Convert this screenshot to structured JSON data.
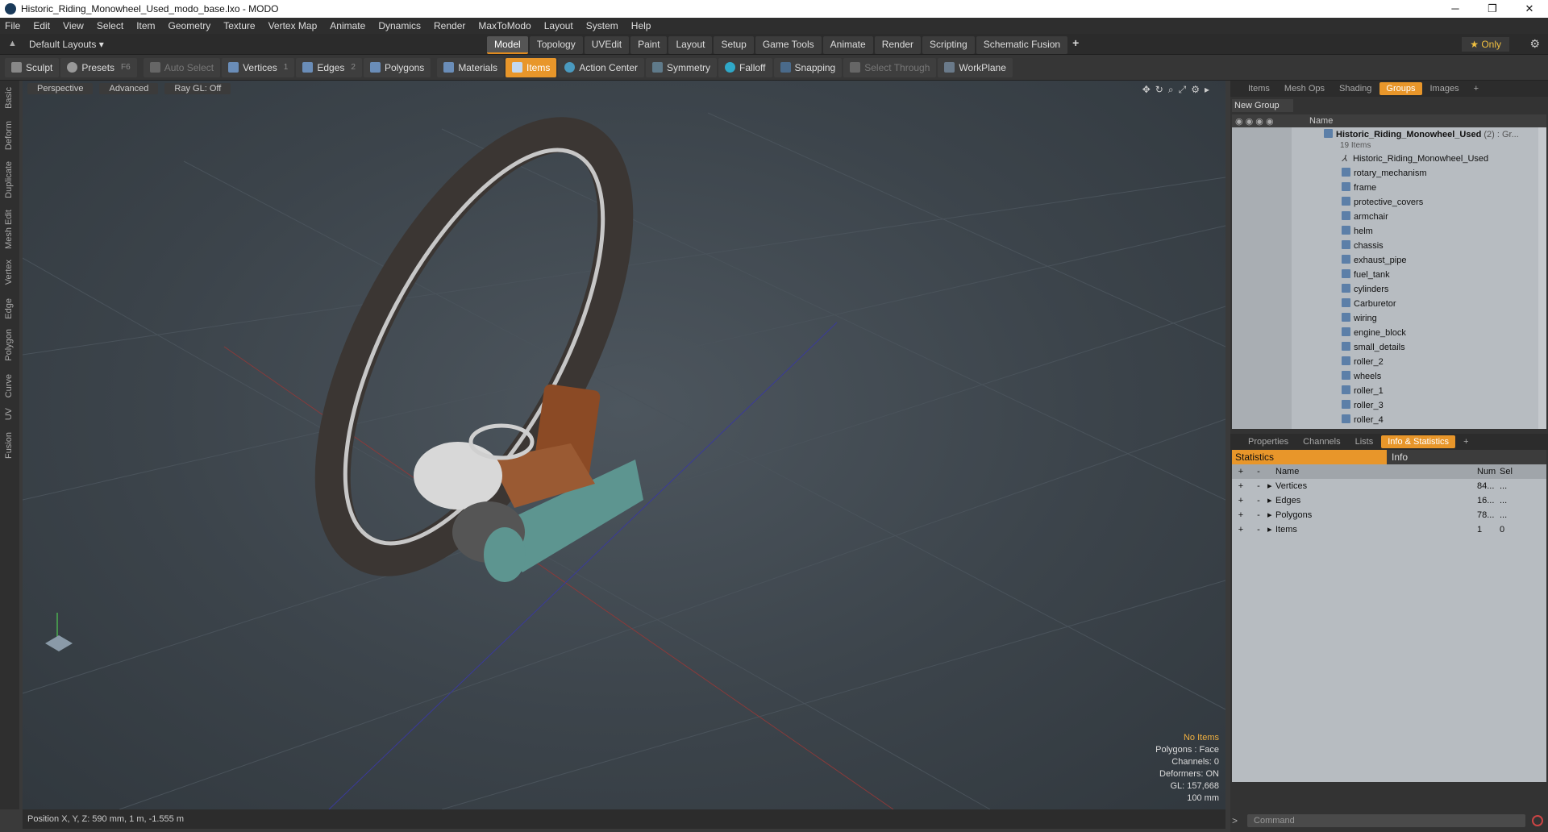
{
  "window": {
    "title": "Historic_Riding_Monowheel_Used_modo_base.lxo - MODO",
    "min": "─",
    "max": "❐",
    "close": "✕"
  },
  "menu": [
    "File",
    "Edit",
    "View",
    "Select",
    "Item",
    "Geometry",
    "Texture",
    "Vertex Map",
    "Animate",
    "Dynamics",
    "Render",
    "MaxToModo",
    "Layout",
    "System",
    "Help"
  ],
  "layout": {
    "default_layouts": "Default Layouts ▾",
    "only": "★ Only"
  },
  "tabs": [
    "Model",
    "Topology",
    "UVEdit",
    "Paint",
    "Layout",
    "Setup",
    "Game Tools",
    "Animate",
    "Render",
    "Scripting",
    "Schematic Fusion"
  ],
  "toolbar": {
    "sculpt": "Sculpt",
    "presets": "Presets",
    "presets_key": "F6",
    "auto_select": "Auto Select",
    "vertices": "Vertices",
    "vertices_n": "1",
    "edges": "Edges",
    "edges_n": "2",
    "polygons": "Polygons",
    "materials": "Materials",
    "items": "Items",
    "action_center": "Action Center",
    "symmetry": "Symmetry",
    "falloff": "Falloff",
    "snapping": "Snapping",
    "select_through": "Select Through",
    "workplane": "WorkPlane"
  },
  "left_tabs": [
    "Basic",
    "Deform",
    "Duplicate",
    "Mesh Edit",
    "Vertex",
    "Edge",
    "Polygon",
    "Curve",
    "UV",
    "Fusion"
  ],
  "viewport": {
    "perspective": "Perspective",
    "advanced": "Advanced",
    "raygl": "Ray GL: Off",
    "info": {
      "no_items": "No Items",
      "polygons": "Polygons : Face",
      "channels": "Channels: 0",
      "deformers": "Deformers: ON",
      "gl": "GL: 157,668",
      "scale": "100 mm"
    }
  },
  "status": {
    "position": "Position X, Y, Z:   590 mm, 1 m, -1.555 m"
  },
  "panel_tabs_top": [
    "Items",
    "Mesh Ops",
    "Shading",
    "Groups",
    "Images"
  ],
  "groups": {
    "new_group": "New Group",
    "col_name": "Name",
    "root": "Historic_Riding_Monowheel_Used",
    "root_suffix": "(2) : Gr...",
    "root_count": "19 Items",
    "items": [
      "Historic_Riding_Monowheel_Used",
      "rotary_mechanism",
      "frame",
      "protective_covers",
      "armchair",
      "helm",
      "chassis",
      "exhaust_pipe",
      "fuel_tank",
      "cylinders",
      "Carburetor",
      "wiring",
      "engine_block",
      "small_details",
      "roller_2",
      "wheels",
      "roller_1",
      "roller_3",
      "roller_4"
    ]
  },
  "panel_tabs_bottom": [
    "Properties",
    "Channels",
    "Lists",
    "Info & Statistics"
  ],
  "stats": {
    "tab_statistics": "Statistics",
    "tab_info": "Info",
    "headers": {
      "name": "Name",
      "num": "Num",
      "sel": "Sel"
    },
    "rows": [
      {
        "name": "Vertices",
        "num": "84...",
        "sel": "..."
      },
      {
        "name": "Edges",
        "num": "16...",
        "sel": "..."
      },
      {
        "name": "Polygons",
        "num": "78...",
        "sel": "..."
      },
      {
        "name": "Items",
        "num": "1",
        "sel": "0"
      }
    ]
  },
  "command": {
    "placeholder": "Command"
  }
}
